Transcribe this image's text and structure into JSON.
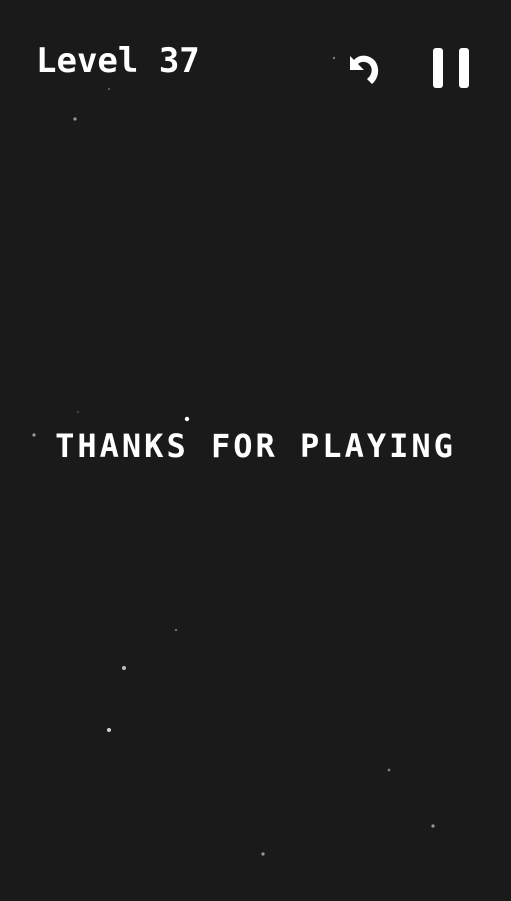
{
  "hud": {
    "level_label": "Level 37",
    "undo_icon": "undo-icon",
    "pause_icon": "pause-icon"
  },
  "message": {
    "text": "THANKS FOR PLAYING"
  },
  "colors": {
    "background": "#1a1a1a",
    "foreground": "#ffffff",
    "star": "#bdbdbd"
  }
}
